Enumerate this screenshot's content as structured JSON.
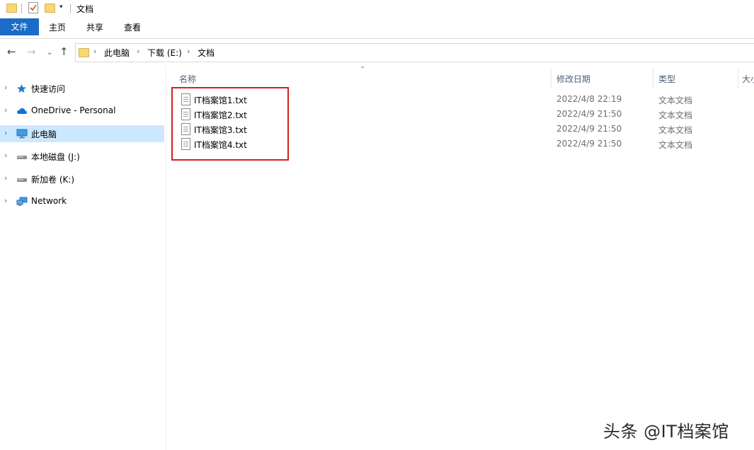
{
  "window": {
    "title": "文档"
  },
  "ribbon": {
    "tabs": [
      "文件",
      "主页",
      "共享",
      "查看"
    ]
  },
  "address": {
    "crumbs": [
      "此电脑",
      "下载 (E:)",
      "文档"
    ]
  },
  "sidebar": {
    "items": [
      {
        "label": "快速访问",
        "icon": "star-icon",
        "selected": false
      },
      {
        "label": "OneDrive - Personal",
        "icon": "cloud-icon",
        "selected": false
      },
      {
        "label": "此电脑",
        "icon": "monitor-icon",
        "selected": true
      },
      {
        "label": "本地磁盘 (J:)",
        "icon": "drive-icon",
        "selected": false
      },
      {
        "label": "新加卷 (K:)",
        "icon": "drive-icon",
        "selected": false
      },
      {
        "label": "Network",
        "icon": "network-icon",
        "selected": false
      }
    ]
  },
  "file_list": {
    "columns": {
      "name": "名称",
      "date": "修改日期",
      "type": "类型",
      "size": "大小"
    },
    "files": [
      {
        "name": "IT档案馆1.txt",
        "date": "2022/4/8 22:19",
        "type": "文本文档"
      },
      {
        "name": "IT档案馆2.txt",
        "date": "2022/4/9 21:50",
        "type": "文本文档"
      },
      {
        "name": "IT档案馆3.txt",
        "date": "2022/4/9 21:50",
        "type": "文本文档"
      },
      {
        "name": "IT档案馆4.txt",
        "date": "2022/4/9 21:50",
        "type": "文本文档"
      }
    ]
  },
  "watermark": {
    "text": "头条 @IT档案馆"
  },
  "colors": {
    "accent": "#1a6cc6",
    "selection": "#cce8ff",
    "highlight_border": "#d32020"
  }
}
